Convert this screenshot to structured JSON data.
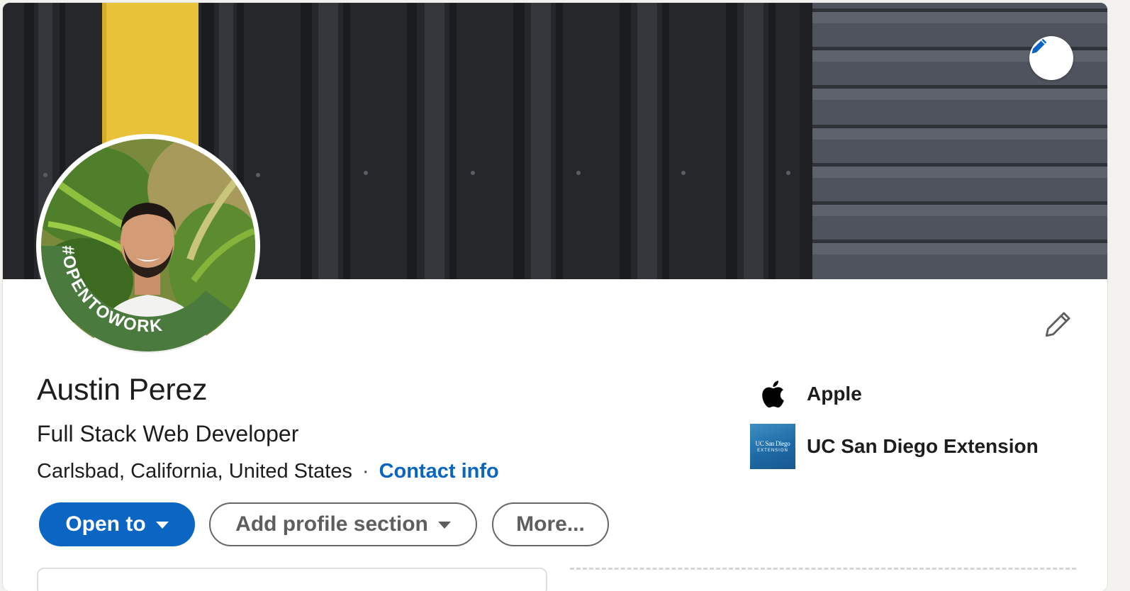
{
  "profile": {
    "name": "Austin Perez",
    "headline": "Full Stack Web Developer",
    "location": "Carlsbad, California, United States",
    "separator": "·",
    "contact_link": "Contact info",
    "open_to_work_frame": "#OPENTOWORK"
  },
  "actions": {
    "open_to": "Open to",
    "add_profile_section": "Add profile section",
    "more": "More..."
  },
  "organizations": [
    {
      "name": "Apple",
      "icon": "apple-logo-icon"
    },
    {
      "name": "UC San Diego Extension",
      "logo_line1": "UC San Diego",
      "logo_line2": "EXTENSION"
    }
  ],
  "icons": {
    "banner_edit": "pencil-icon",
    "intro_edit": "pencil-outline-icon"
  },
  "colors": {
    "brand_blue": "#0a66c2",
    "open_to_work_green": "#4b7a3e",
    "banner_yellow": "#e8c33a"
  }
}
